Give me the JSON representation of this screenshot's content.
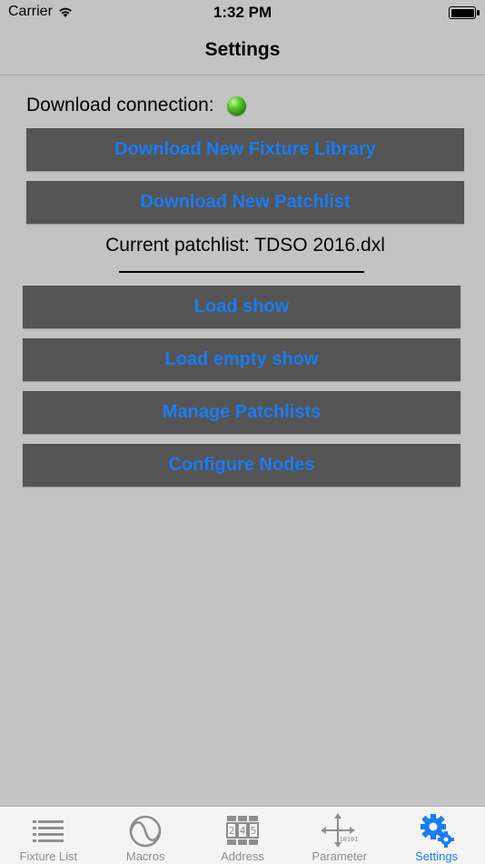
{
  "status": {
    "carrier": "Carrier",
    "time": "1:32 PM"
  },
  "nav": {
    "title": "Settings"
  },
  "connection": {
    "label": "Download connection:",
    "status_color": "#3cb016"
  },
  "actions_top": [
    {
      "label": "Download New Fixture Library"
    },
    {
      "label": "Download New Patchlist"
    }
  ],
  "patchlist": {
    "label": "Current patchlist: TDSO 2016.dxl"
  },
  "actions_bottom": [
    {
      "label": "Load show"
    },
    {
      "label": "Load empty show"
    },
    {
      "label": "Manage Patchlists"
    },
    {
      "label": "Configure Nodes"
    }
  ],
  "tabs": [
    {
      "label": "Fixture List",
      "icon": "list-icon"
    },
    {
      "label": "Macros",
      "icon": "sine-wave-icon"
    },
    {
      "label": "Address",
      "icon": "address-counter-icon",
      "digits": [
        "2",
        "4",
        "5"
      ]
    },
    {
      "label": "Parameter",
      "icon": "move-arrows-icon",
      "caption": "10101"
    },
    {
      "label": "Settings",
      "icon": "gears-icon",
      "active": true
    }
  ],
  "colors": {
    "background": "#c3c3c3",
    "button": "#545454",
    "accent": "#1a7cf5"
  }
}
